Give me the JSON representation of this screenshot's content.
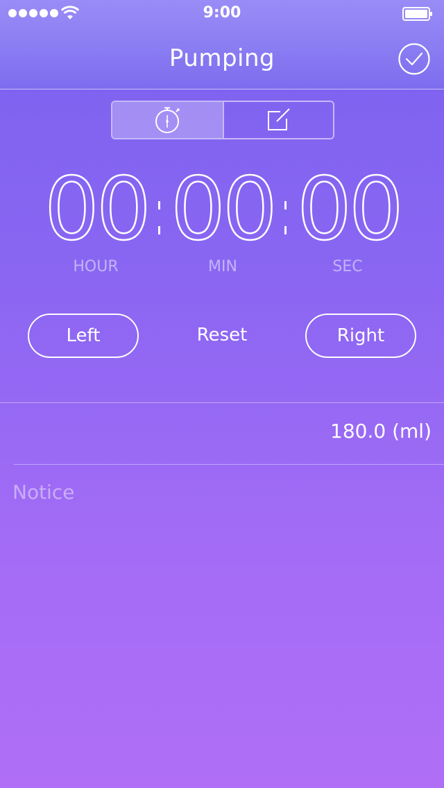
{
  "status_bar": {
    "time": "9:00",
    "signal_bars": 5
  },
  "nav": {
    "title": "Pumping",
    "done_icon": "checkmark-circle-icon"
  },
  "segments": [
    {
      "icon": "stopwatch-icon",
      "selected": true
    },
    {
      "icon": "edit-icon",
      "selected": false
    }
  ],
  "timer": {
    "hours": "00",
    "minutes": "00",
    "seconds": "00",
    "hour_label": "HOUR",
    "min_label": "MIN",
    "sec_label": "SEC"
  },
  "controls": {
    "left_label": "Left",
    "reset_label": "Reset",
    "right_label": "Right"
  },
  "volume": {
    "value": "180.0 (ml)"
  },
  "notice": {
    "placeholder": "Notice"
  },
  "colors": {
    "accent": "#ffffff",
    "background_top": "#7a62ef",
    "background_bottom": "#b06ef6"
  }
}
